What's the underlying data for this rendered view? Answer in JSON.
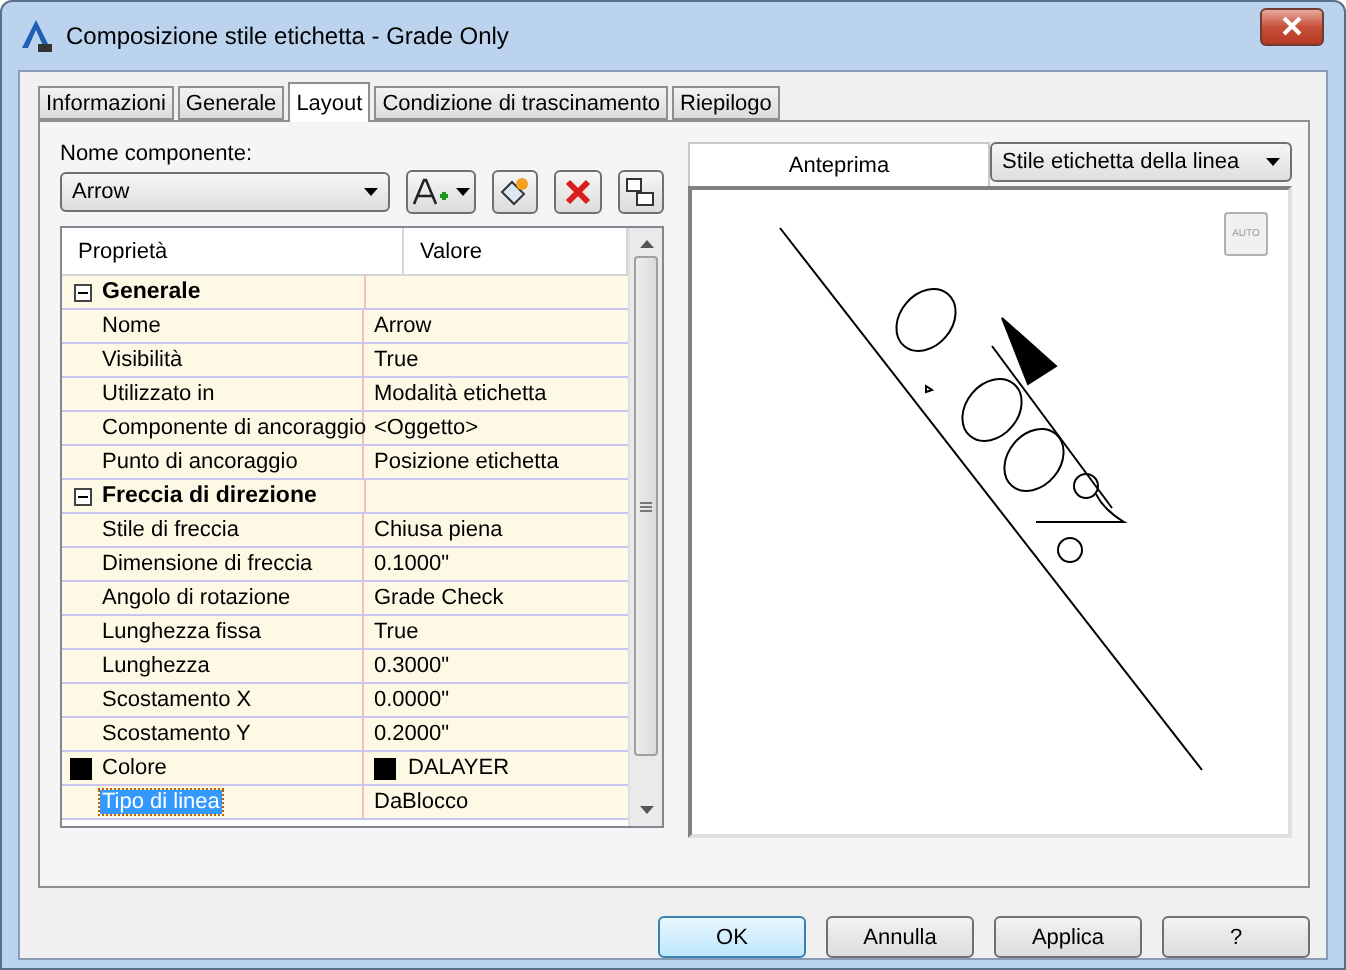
{
  "window": {
    "title": "Composizione stile etichetta - Grade Only"
  },
  "tabs": [
    {
      "label": "Informazioni",
      "selected": false
    },
    {
      "label": "Generale",
      "selected": false
    },
    {
      "label": "Layout",
      "selected": true
    },
    {
      "label": "Condizione di trascinamento",
      "selected": false
    },
    {
      "label": "Riepilogo",
      "selected": false
    }
  ],
  "component": {
    "label": "Nome componente:",
    "value": "Arrow"
  },
  "grid": {
    "columns": [
      "Proprietà",
      "Valore"
    ],
    "groups": [
      {
        "name": "Generale",
        "expanded": true,
        "rows": [
          {
            "property": "Nome",
            "value": "Arrow",
            "selected": false
          },
          {
            "property": "Visibilità",
            "value": "True",
            "selected": false
          },
          {
            "property": "Utilizzato in",
            "value": "Modalità etichetta",
            "selected": false
          },
          {
            "property": "Componente di ancoraggio",
            "value": "<Oggetto>",
            "selected": false
          },
          {
            "property": "Punto di ancoraggio",
            "value": "Posizione etichetta",
            "selected": false
          }
        ]
      },
      {
        "name": "Freccia di direzione",
        "expanded": true,
        "rows": [
          {
            "property": "Stile di freccia",
            "value": "Chiusa piena",
            "selected": false
          },
          {
            "property": "Dimensione di freccia",
            "value": "0.1000\"",
            "selected": false
          },
          {
            "property": "Angolo di rotazione",
            "value": "Grade Check",
            "selected": false
          },
          {
            "property": "Lunghezza fissa",
            "value": "True",
            "selected": false
          },
          {
            "property": "Lunghezza",
            "value": "0.3000\"",
            "selected": false
          },
          {
            "property": "Scostamento X",
            "value": "0.0000\"",
            "selected": false
          },
          {
            "property": "Scostamento Y",
            "value": "0.2000\"",
            "selected": false
          },
          {
            "property": "Colore",
            "value": "DALAYER",
            "selected": false,
            "color": "#000000"
          },
          {
            "property": "Tipo di linea",
            "value": "DaBlocco",
            "selected": true
          }
        ]
      }
    ]
  },
  "preview": {
    "label": "Anteprima",
    "style": "Stile etichetta della linea",
    "auto": "AUTO"
  },
  "buttons": [
    {
      "label": "OK",
      "default": true
    },
    {
      "label": "Annulla",
      "default": false
    },
    {
      "label": "Applica",
      "default": false
    },
    {
      "label": "?",
      "default": false
    }
  ]
}
